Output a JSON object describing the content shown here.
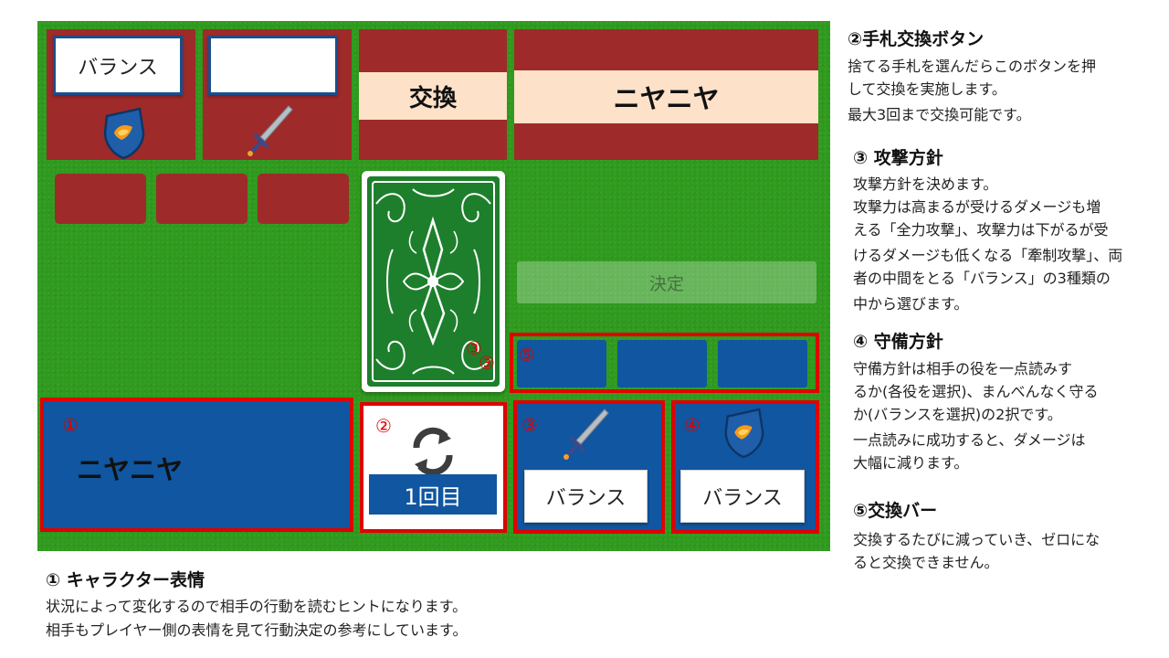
{
  "board": {
    "opponent": {
      "defense_label": "バランス",
      "attack_label": ""
    },
    "exchange_banner": "交換",
    "opponent_expression": "ニヤニヤ",
    "decide_button": "決定",
    "player_expression": "ニヤニヤ",
    "exchange_count": "1回目",
    "attack_policy": "バランス",
    "defense_policy": "バランス",
    "markers": {
      "m1": "①",
      "m2": "②",
      "m3": "③",
      "m4": "④",
      "m5": "⑤"
    }
  },
  "notes": {
    "exchange_button": {
      "title": "②手札交換ボタン",
      "lines": [
        "捨てる手札を選んだらこのボタンを押",
        "して交換を実施します。",
        "最大3回まで交換可能です。"
      ]
    },
    "attack_policy": {
      "title": "③ 攻撃方針",
      "lines": [
        "攻撃方針を決めます。",
        "攻撃力は高まるが受けるダメージも増",
        "える「全力攻撃」、攻撃力は下がるが受",
        "けるダメージも低くなる「牽制攻撃」、両",
        "者の中間をとる「バランス」の3種類の",
        "中から選びます。"
      ]
    },
    "defense_policy": {
      "title": "④ 守備方針",
      "lines": [
        "守備方針は相手の役を一点読みす",
        "るか(各役を選択)、まんべんなく守る",
        "か(バランスを選択)の2択です。",
        "一点読みに成功すると、ダメージは",
        "大幅に減ります。"
      ]
    },
    "exchange_bar": {
      "title": "⑤交換バー",
      "lines": [
        "交換するたびに減っていき、ゼロにな",
        "ると交換できません。"
      ]
    },
    "character_expression": {
      "title": "① キャラクター表情",
      "lines": [
        "状況によって変化するので相手の行動を読むヒントになります。",
        "相手もプレイヤー側の表情を見て行動決定の参考にしています。"
      ]
    }
  },
  "colors": {
    "felt": "#2f9a1e",
    "panel_red": "#9f2a2a",
    "panel_blue": "#1056a0",
    "highlight": "#e00000",
    "band": "#fde1c8"
  }
}
